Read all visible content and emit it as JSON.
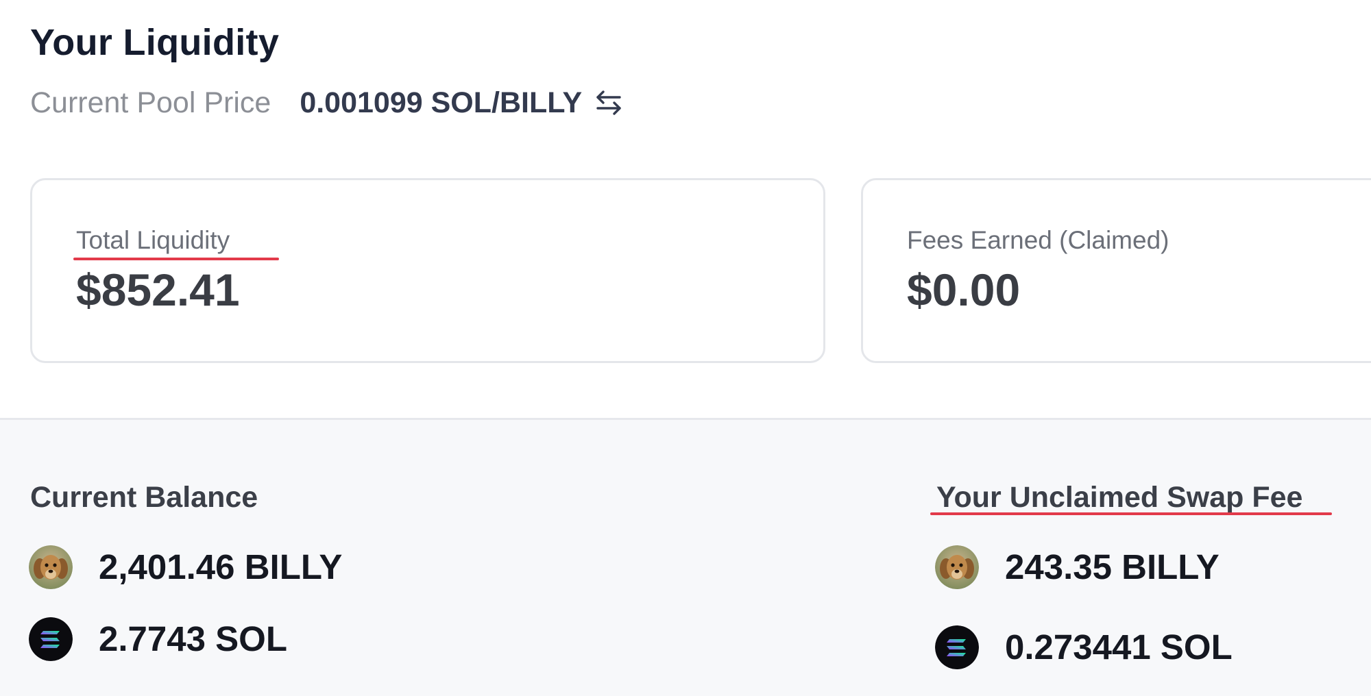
{
  "header": {
    "title": "Your Liquidity",
    "price_label": "Current Pool Price",
    "price_value": "0.001099 SOL/BILLY",
    "swap_icon": "swap-arrows-icon"
  },
  "cards": {
    "total_liquidity": {
      "label": "Total Liquidity",
      "value": "$852.41"
    },
    "fees_earned": {
      "label": "Fees Earned (Claimed)",
      "value": "$0.00"
    }
  },
  "balance": {
    "title": "Current Balance",
    "billy": "2,401.46 BILLY",
    "sol": "2.7743 SOL"
  },
  "unclaimed": {
    "title": "Your Unclaimed Swap Fee",
    "billy": "243.35 BILLY",
    "sol": "0.273441 SOL"
  },
  "colors": {
    "highlight_underline": "#e23a4a",
    "title_text": "#151c2e",
    "bottom_background": "#f7f8fa"
  },
  "icons": {
    "billy_token": "dog-avatar-icon",
    "sol_token": "solana-logo-icon"
  }
}
